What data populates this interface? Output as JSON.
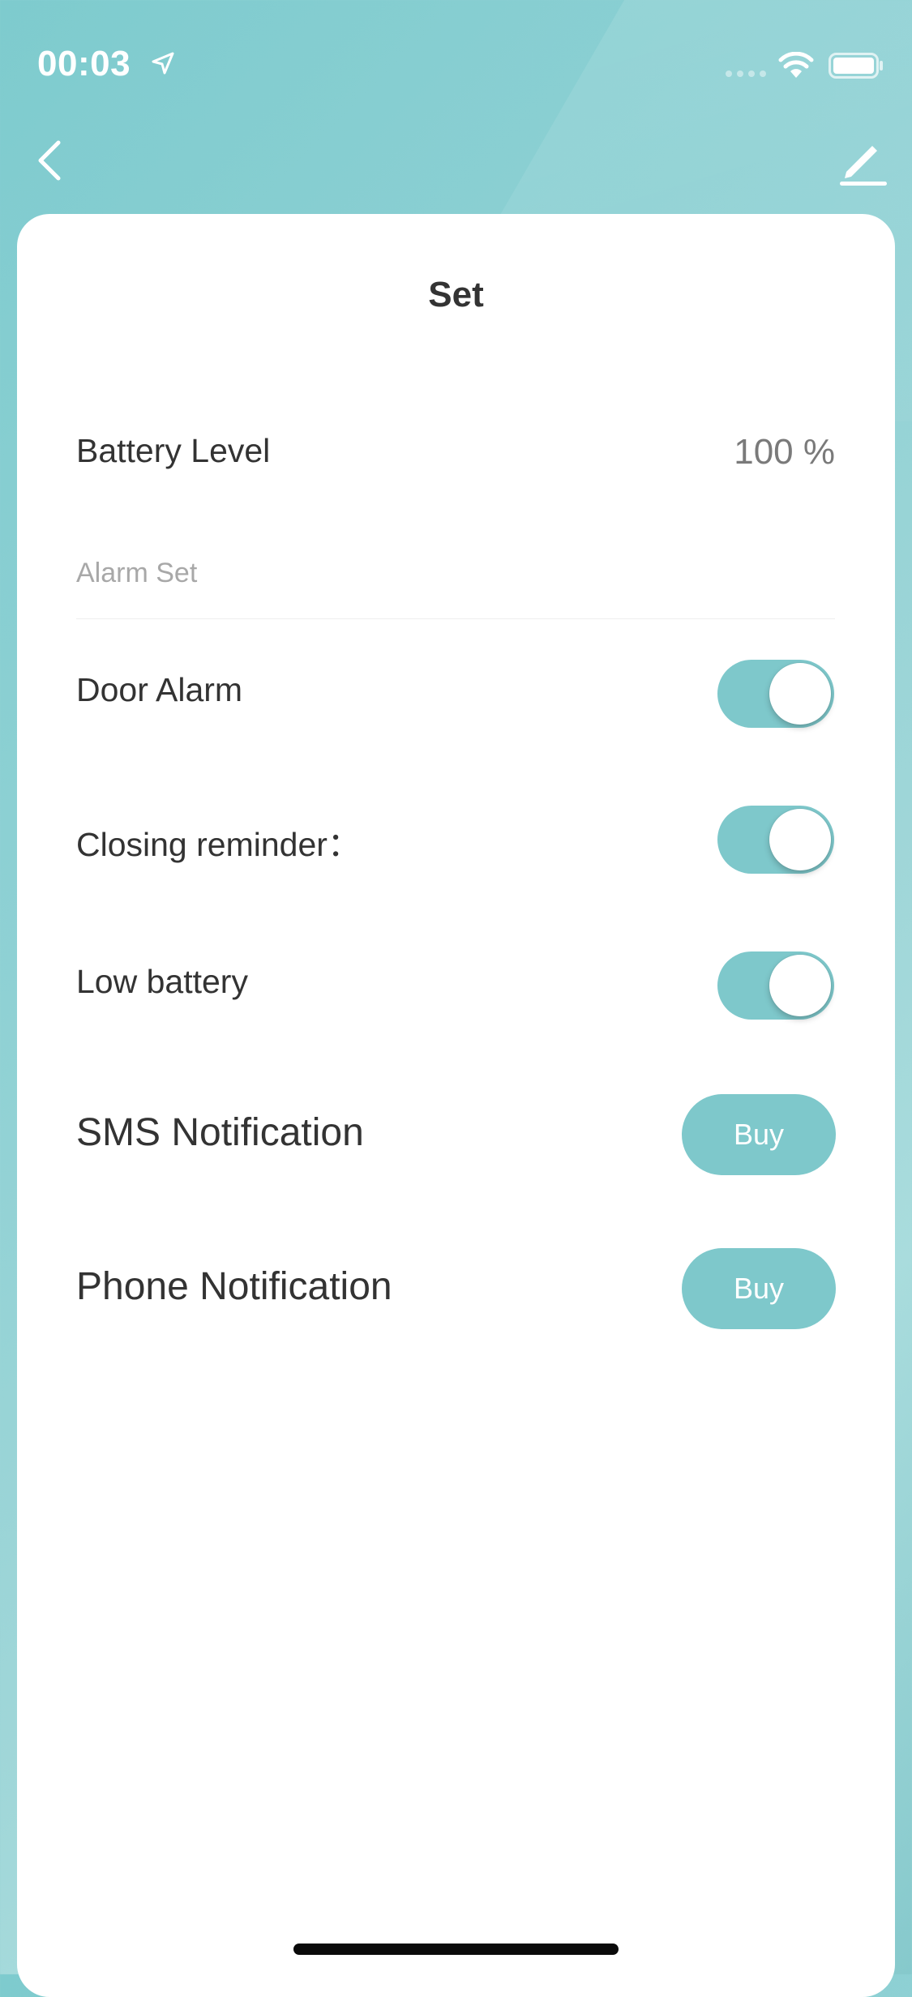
{
  "status_bar": {
    "time": "00:03",
    "icons": [
      "location-arrow-icon",
      "cellular-signal-icon",
      "wifi-icon",
      "battery-icon"
    ]
  },
  "nav": {
    "back_icon": "chevron-left-icon",
    "edit_icon": "pencil-icon"
  },
  "page": {
    "title": "Set"
  },
  "battery": {
    "label": "Battery Level",
    "value": "100 %"
  },
  "alarm_section": {
    "header": "Alarm Set",
    "items": [
      {
        "label": "Door Alarm",
        "enabled": true
      },
      {
        "label": "Closing reminder：",
        "enabled": true
      },
      {
        "label": "Low battery",
        "enabled": true
      }
    ]
  },
  "notifications": [
    {
      "label": "SMS Notification",
      "button": "Buy"
    },
    {
      "label": "Phone Notification",
      "button": "Buy"
    }
  ],
  "colors": {
    "accent": "#7ec8cb",
    "background_teal": "#8fd1d4",
    "text_primary": "#333333",
    "text_secondary": "#a8a8a8"
  }
}
